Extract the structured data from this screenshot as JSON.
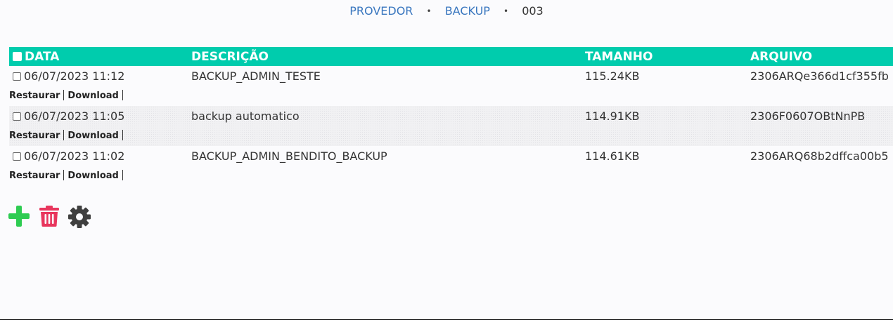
{
  "breadcrumb": {
    "items": [
      "PROVEDOR",
      "BACKUP"
    ],
    "current": "003",
    "separator": "•"
  },
  "table": {
    "headers": {
      "data": "DATA",
      "descricao": "DESCRIÇÃO",
      "tamanho": "TAMANHO",
      "arquivo": "ARQUIVO"
    },
    "rows": [
      {
        "data": "06/07/2023 11:12",
        "descricao": "BACKUP_ADMIN_TESTE",
        "tamanho": "115.24KB",
        "arquivo": "2306ARQe366d1cf355fb",
        "actions": [
          "Restaurar",
          "Download"
        ]
      },
      {
        "data": "06/07/2023 11:05",
        "descricao": "backup automatico",
        "tamanho": "114.91KB",
        "arquivo": "2306F0607OBtNnPB",
        "actions": [
          "Restaurar",
          "Download"
        ]
      },
      {
        "data": "06/07/2023 11:02",
        "descricao": "BACKUP_ADMIN_BENDITO_BACKUP",
        "tamanho": "114.61KB",
        "arquivo": "2306ARQ68b2dffca00b5",
        "actions": [
          "Restaurar",
          "Download"
        ]
      }
    ]
  },
  "toolbar": {
    "icons": [
      "plus-icon",
      "trash-icon",
      "gear-icon"
    ]
  },
  "colors": {
    "header_bg": "#00ccad",
    "link": "#3a77bf",
    "plus": "#2ecc52",
    "trash": "#e8365d",
    "gear": "#3f3f3f"
  }
}
